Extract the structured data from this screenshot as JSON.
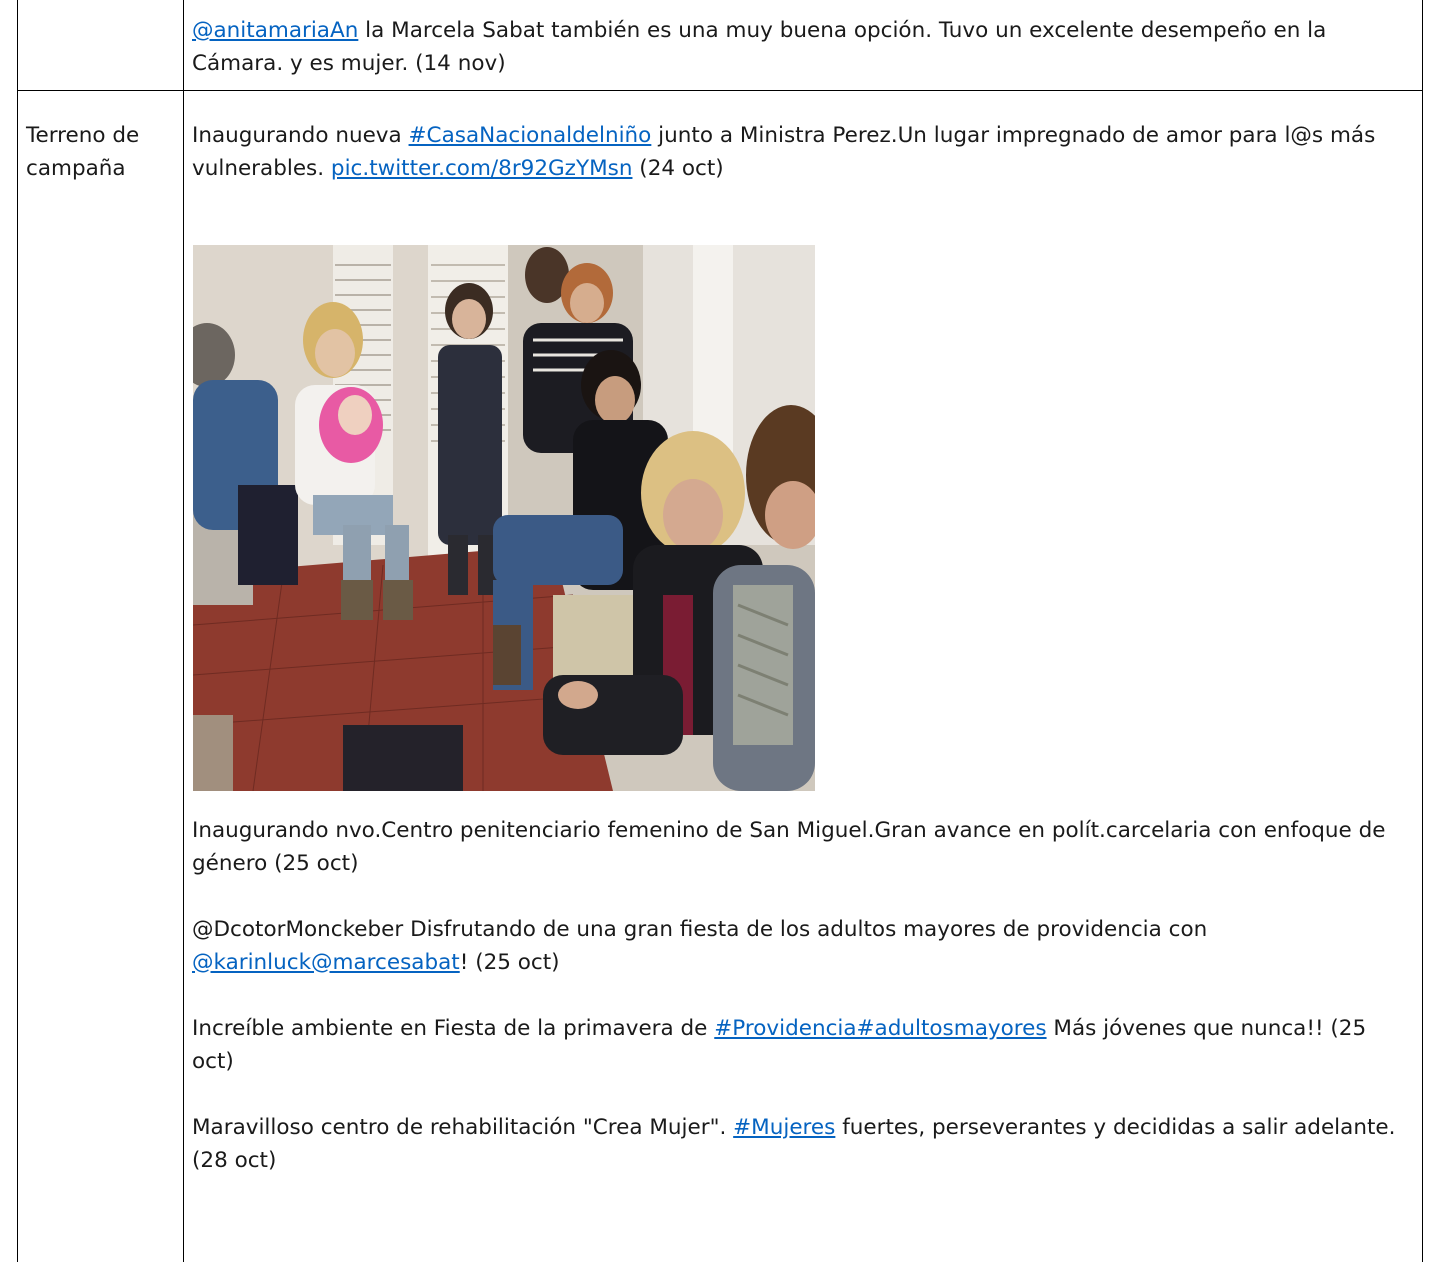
{
  "rows": [
    {
      "label": "",
      "entries": [
        {
          "link": "@anitamariaAn",
          "text": " la Marcela Sabat también es una muy buena opción. Tuvo un excelente desempeño en la Cámara. y es mujer. (14 nov)"
        }
      ]
    },
    {
      "label": "Terreno de campaña",
      "entries": [
        {
          "before": "Inaugurando nueva ",
          "link1": "#CasaNacionaldelniño",
          "middle": " junto a Ministra Perez.Un lugar impregnado de amor para l@s más vulnerables. ",
          "link2": "pic.twitter.com/8r92GzYMsn",
          "after": " (24 oct)"
        },
        {
          "text": "Inaugurando nvo.Centro penitenciario femenino de San Miguel.Gran avance en polít.carcelaria con enfoque de género (25 oct)"
        },
        {
          "before": "@DcotorMonckeber Disfrutando de una gran fiesta de los adultos mayores de providencia con ",
          "link": "@karinluck@marcesabat",
          "after": "! (25 oct)"
        },
        {
          "before": "Increíble ambiente en Fiesta de la primavera de ",
          "link": "#Providencia#adultosmayores",
          "after": " Más jóvenes que nunca!! (25 oct)"
        },
        {
          "before": "Maravilloso centro de rehabilitación \"Crea Mujer\". ",
          "link": "#Mujeres",
          "after": " fuertes, perseverantes y decididas a salir adelante. (28 oct)"
        }
      ]
    }
  ]
}
